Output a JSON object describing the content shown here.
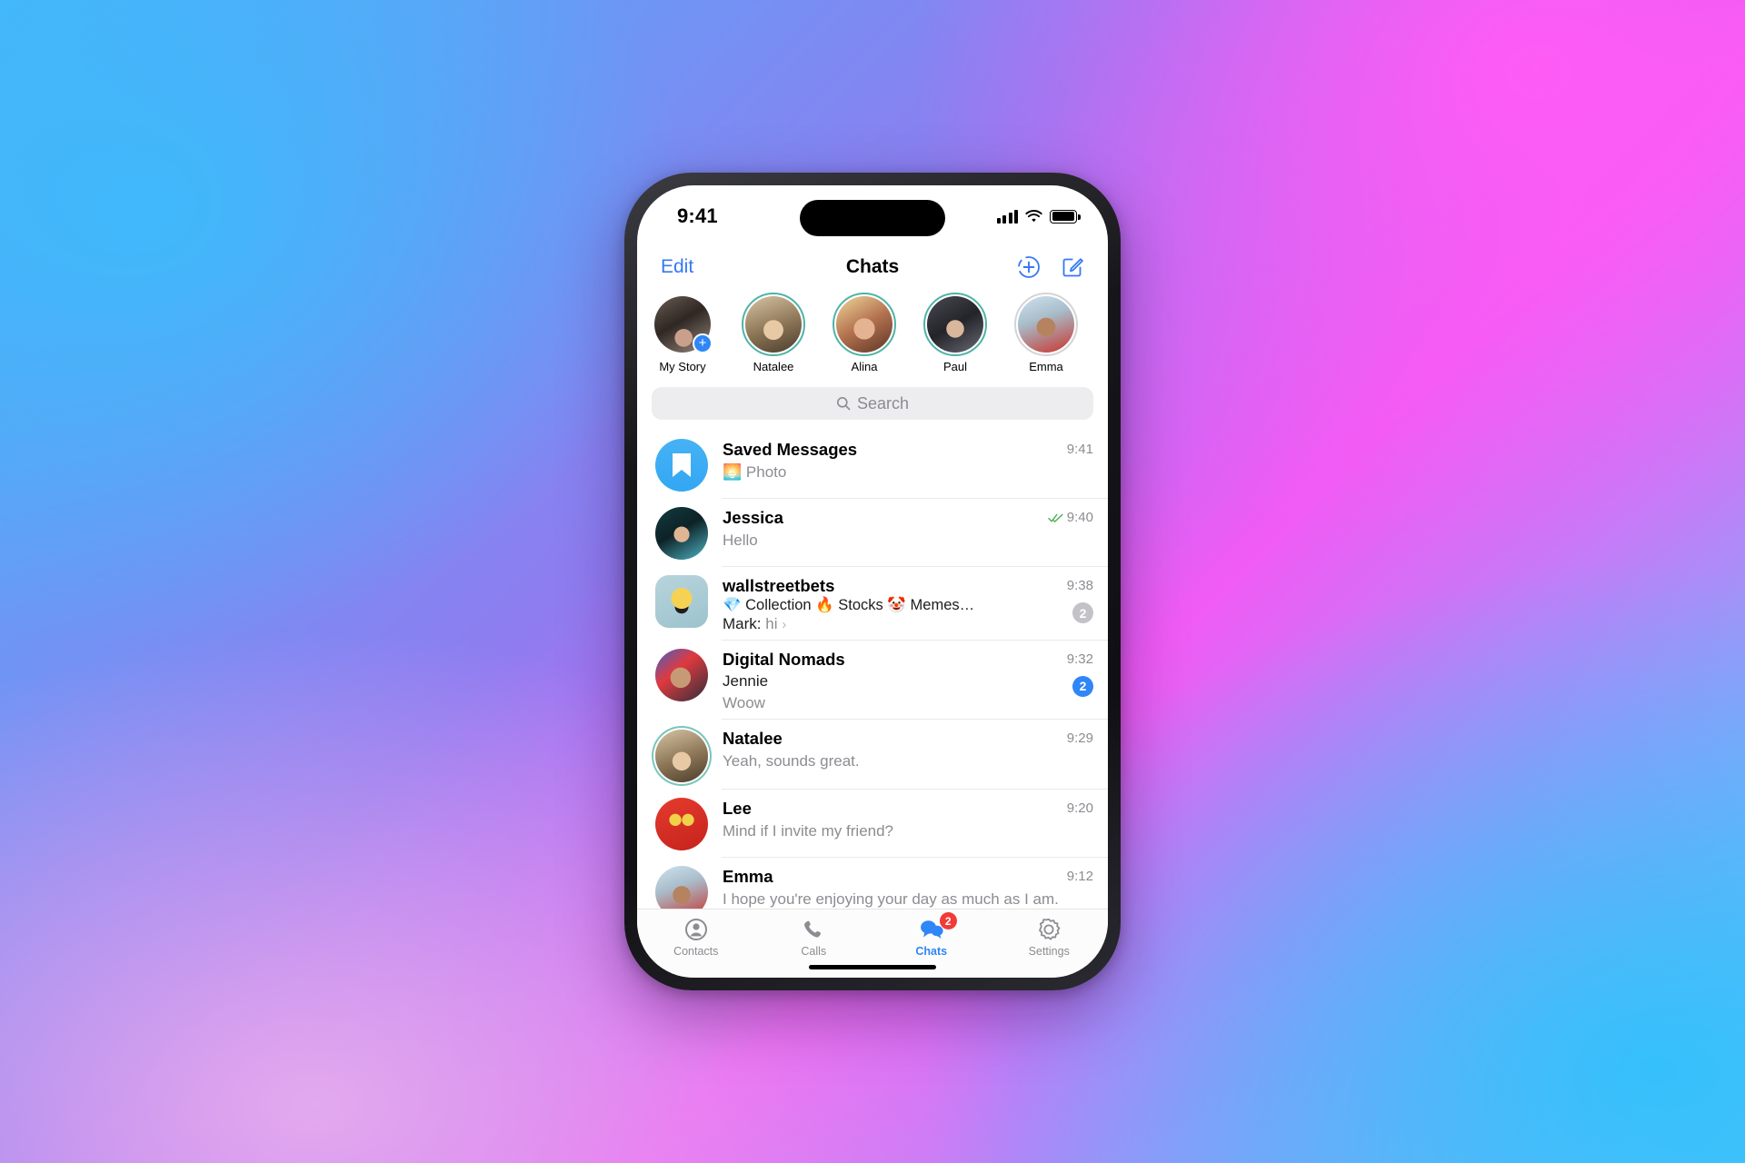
{
  "status_bar": {
    "time": "9:41",
    "signal_icon": "cellular-bars-icon",
    "wifi_icon": "wifi-icon",
    "battery_icon": "battery-full-icon"
  },
  "nav": {
    "edit_label": "Edit",
    "title": "Chats",
    "add_story_icon": "add-story-icon",
    "compose_icon": "compose-icon"
  },
  "stories": [
    {
      "name": "My Story",
      "ring": "none",
      "has_add": true
    },
    {
      "name": "Natalee",
      "ring": "teal",
      "has_add": false
    },
    {
      "name": "Alina",
      "ring": "teal",
      "has_add": false
    },
    {
      "name": "Paul",
      "ring": "teal",
      "has_add": false
    },
    {
      "name": "Emma",
      "ring": "gray",
      "has_add": false
    }
  ],
  "search": {
    "placeholder": "Search",
    "icon": "search-icon"
  },
  "chats": [
    {
      "title": "Saved Messages",
      "preview": "Photo",
      "preview_emoji": "🌅",
      "time": "9:41",
      "avatar_type": "saved",
      "badge": "",
      "badge_muted": false,
      "read_receipt": false
    },
    {
      "title": "Jessica",
      "preview": "Hello",
      "time": "9:40",
      "avatar_type": "photo",
      "badge": "",
      "badge_muted": false,
      "read_receipt": true
    },
    {
      "title": "wallstreetbets",
      "topics": "💎 Collection  🔥 Stocks  🤡 Memes…",
      "sender": "Mark:",
      "reply": "hi",
      "chevron": "›",
      "time": "9:38",
      "avatar_type": "square",
      "badge": "2",
      "badge_muted": true,
      "read_receipt": false
    },
    {
      "title": "Digital Nomads",
      "sender": "Jennie",
      "preview": "Woow",
      "time": "9:32",
      "avatar_type": "photo",
      "badge": "2",
      "badge_muted": false,
      "read_receipt": false
    },
    {
      "title": "Natalee",
      "preview": "Yeah, sounds great.",
      "time": "9:29",
      "avatar_type": "photo-ringed",
      "badge": "",
      "badge_muted": false,
      "read_receipt": false
    },
    {
      "title": "Lee",
      "preview": "Mind if I invite my friend?",
      "time": "9:20",
      "avatar_type": "photo",
      "badge": "",
      "badge_muted": false,
      "read_receipt": false
    },
    {
      "title": "Emma",
      "preview": "I hope you're enjoying your day as much as I am.",
      "time": "9:12",
      "avatar_type": "photo",
      "badge": "",
      "badge_muted": false,
      "read_receipt": false
    }
  ],
  "tabs": [
    {
      "label": "Contacts",
      "icon": "contacts-icon",
      "active": false,
      "badge": ""
    },
    {
      "label": "Calls",
      "icon": "phone-icon",
      "active": false,
      "badge": ""
    },
    {
      "label": "Chats",
      "icon": "chat-bubbles-icon",
      "active": true,
      "badge": "2"
    },
    {
      "label": "Settings",
      "icon": "gear-icon",
      "active": false,
      "badge": ""
    }
  ],
  "colors": {
    "accent_blue": "#2f86f7",
    "link_blue": "#3478f6",
    "badge_red": "#f03b36",
    "badge_muted": "#c2c2c7",
    "story_ring_teal": "#4fb3a8",
    "check_green": "#4cb050"
  }
}
